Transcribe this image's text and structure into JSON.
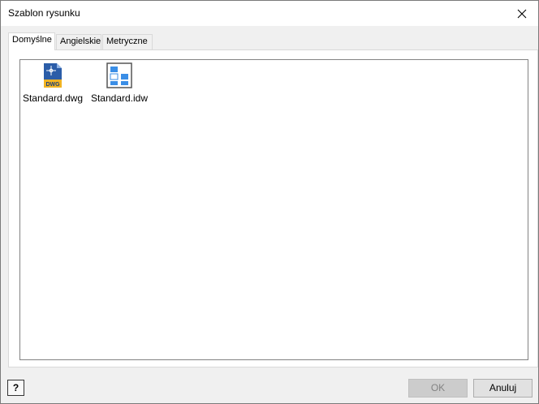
{
  "window": {
    "title": "Szablon rysunku"
  },
  "tabs": [
    {
      "label": "Domyślne",
      "active": true
    },
    {
      "label": "Angielskie",
      "active": false
    },
    {
      "label": "Metryczne",
      "active": false
    }
  ],
  "files": [
    {
      "name": "Standard.dwg",
      "icon": "dwg-file-icon"
    },
    {
      "name": "Standard.idw",
      "icon": "idw-file-icon"
    }
  ],
  "buttons": {
    "ok": "OK",
    "cancel": "Anuluj",
    "ok_enabled": false
  },
  "help": {
    "glyph": "?"
  },
  "colors": {
    "dwg_blue": "#2b5da8",
    "dwg_yellow": "#f0b323",
    "idw_blue": "#3a8ee6"
  }
}
